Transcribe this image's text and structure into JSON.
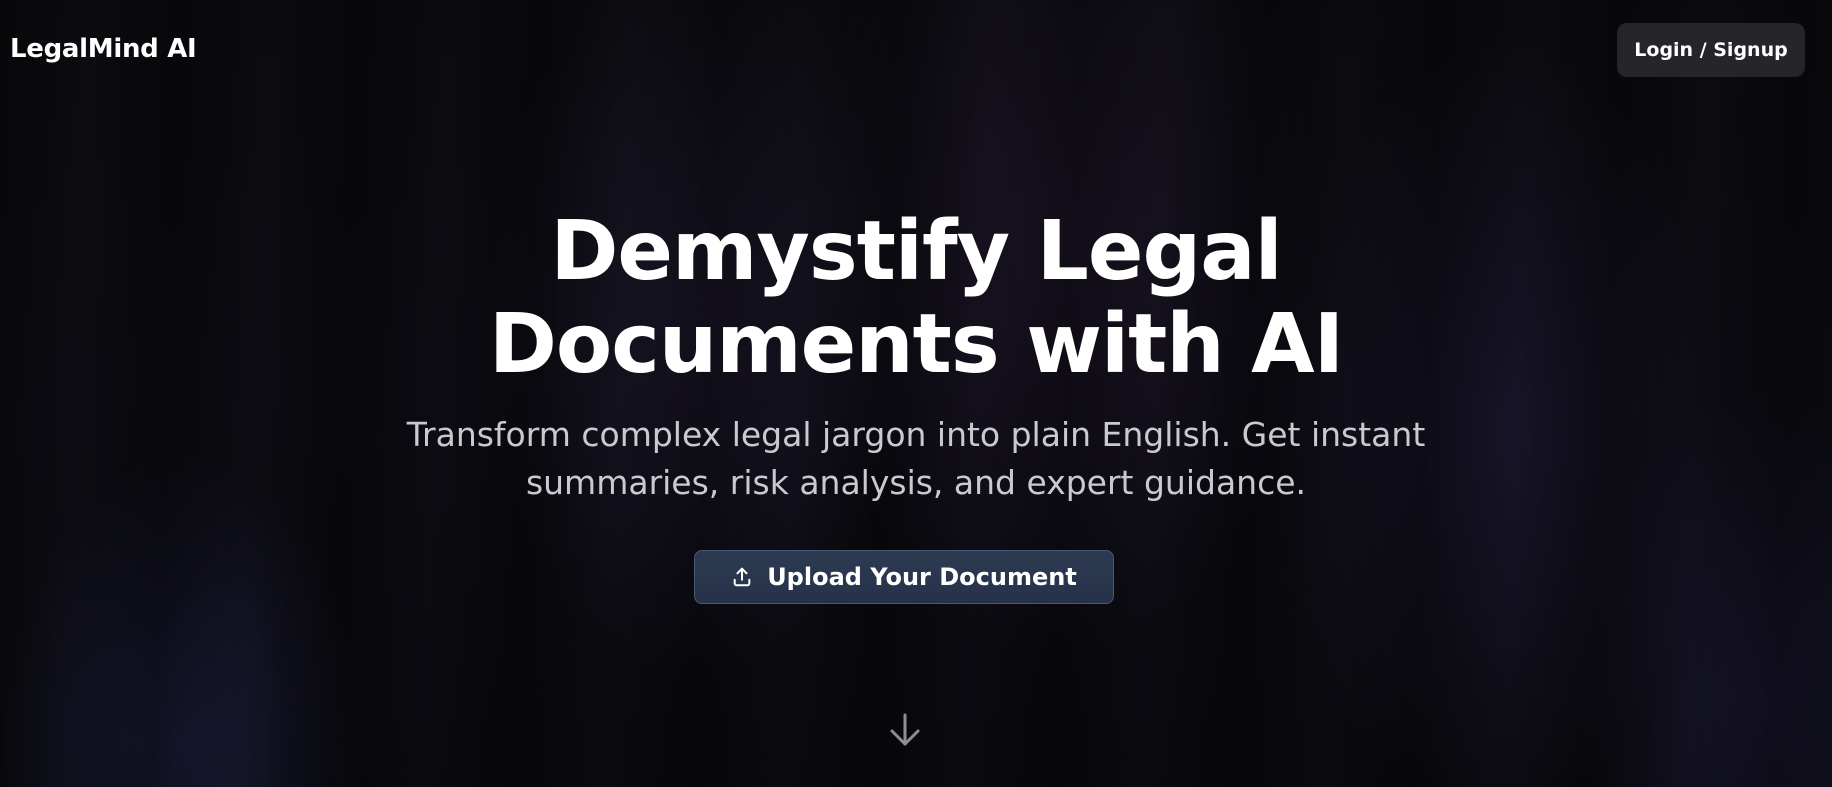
{
  "header": {
    "logo_text": "LegalMind AI",
    "login_label": "Login / Signup"
  },
  "hero": {
    "title_line1": "Demystify Legal",
    "title_line2": "Documents with AI",
    "subtitle_line1": "Transform complex legal jargon into plain English. Get instant",
    "subtitle_line2": "summaries, risk analysis, and expert guidance.",
    "upload_label": "Upload Your Document",
    "upload_icon": "upload-icon",
    "scroll_icon": "arrow-down-icon"
  },
  "colors": {
    "background": "#0b0b0e",
    "login_button_bg": "#26262a",
    "upload_button_bg": "#2d3b52",
    "upload_button_border": "#4a5874",
    "subtitle_text": "#c9c9cf"
  }
}
